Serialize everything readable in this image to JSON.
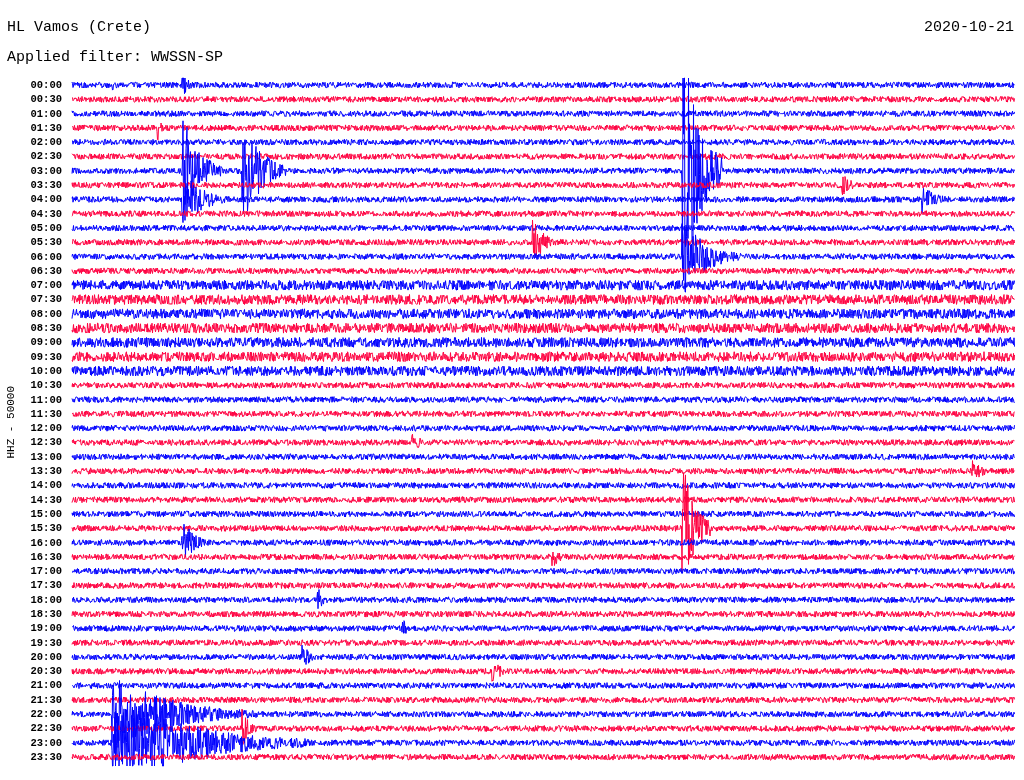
{
  "station": "HL Vamos (Crete)",
  "date": "2020-10-21",
  "filter": "Applied filter: WWSSN-SP",
  "axis_label": "HHZ - 50000",
  "rows": [
    {
      "time": "00:00",
      "color": "#0000ff"
    },
    {
      "time": "00:30",
      "color": "#ff0040"
    },
    {
      "time": "01:00",
      "color": "#0000ff"
    },
    {
      "time": "01:30",
      "color": "#ff0040"
    },
    {
      "time": "02:00",
      "color": "#0000ff"
    },
    {
      "time": "02:30",
      "color": "#ff0040"
    },
    {
      "time": "03:00",
      "color": "#0000ff"
    },
    {
      "time": "03:30",
      "color": "#ff0040"
    },
    {
      "time": "04:00",
      "color": "#0000ff"
    },
    {
      "time": "04:30",
      "color": "#ff0040"
    },
    {
      "time": "05:00",
      "color": "#0000ff"
    },
    {
      "time": "05:30",
      "color": "#ff0040"
    },
    {
      "time": "06:00",
      "color": "#0000ff"
    },
    {
      "time": "06:30",
      "color": "#ff0040"
    },
    {
      "time": "07:00",
      "color": "#0000ff"
    },
    {
      "time": "07:30",
      "color": "#ff0040"
    },
    {
      "time": "08:00",
      "color": "#0000ff"
    },
    {
      "time": "08:30",
      "color": "#ff0040"
    },
    {
      "time": "09:00",
      "color": "#0000ff"
    },
    {
      "time": "09:30",
      "color": "#ff0040"
    },
    {
      "time": "10:00",
      "color": "#0000ff"
    },
    {
      "time": "10:30",
      "color": "#ff0040"
    },
    {
      "time": "11:00",
      "color": "#0000ff"
    },
    {
      "time": "11:30",
      "color": "#ff0040"
    },
    {
      "time": "12:00",
      "color": "#0000ff"
    },
    {
      "time": "12:30",
      "color": "#ff0040"
    },
    {
      "time": "13:00",
      "color": "#0000ff"
    },
    {
      "time": "13:30",
      "color": "#ff0040"
    },
    {
      "time": "14:00",
      "color": "#0000ff"
    },
    {
      "time": "14:30",
      "color": "#ff0040"
    },
    {
      "time": "15:00",
      "color": "#0000ff"
    },
    {
      "time": "15:30",
      "color": "#ff0040"
    },
    {
      "time": "16:00",
      "color": "#0000ff"
    },
    {
      "time": "16:30",
      "color": "#ff0040"
    },
    {
      "time": "17:00",
      "color": "#0000ff"
    },
    {
      "time": "17:30",
      "color": "#ff0040"
    },
    {
      "time": "18:00",
      "color": "#0000ff"
    },
    {
      "time": "18:30",
      "color": "#ff0040"
    },
    {
      "time": "19:00",
      "color": "#0000ff"
    },
    {
      "time": "19:30",
      "color": "#ff0040"
    },
    {
      "time": "20:00",
      "color": "#0000ff"
    },
    {
      "time": "20:30",
      "color": "#ff0040"
    },
    {
      "time": "21:00",
      "color": "#0000ff"
    },
    {
      "time": "21:30",
      "color": "#ff0040"
    },
    {
      "time": "22:00",
      "color": "#0000ff"
    },
    {
      "time": "22:30",
      "color": "#ff0040"
    },
    {
      "time": "23:00",
      "color": "#0000ff"
    },
    {
      "time": "23:30",
      "color": "#ff0040"
    }
  ]
}
